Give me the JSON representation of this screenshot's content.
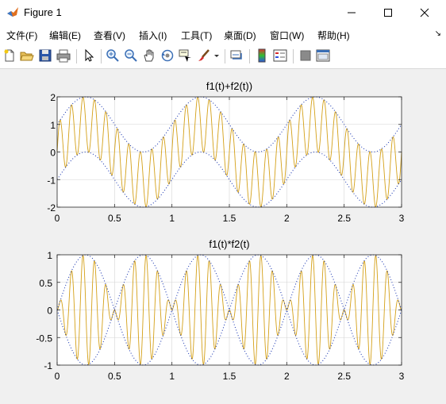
{
  "window": {
    "title": "Figure 1"
  },
  "menu": [
    "文件(F)",
    "编辑(E)",
    "查看(V)",
    "插入(I)",
    "工具(T)",
    "桌面(D)",
    "窗口(W)",
    "帮助(H)"
  ],
  "toolbar_icons": [
    "new-figure-icon",
    "open-file-icon",
    "save-icon",
    "print-icon",
    "edit-plot-arrow-icon",
    "zoom-in-icon",
    "zoom-out-icon",
    "pan-hand-icon",
    "rotate-3d-icon",
    "data-cursor-icon",
    "brush-icon",
    "link-plot-icon",
    "insert-colorbar-icon",
    "insert-legend-icon",
    "hide-plot-tools-icon",
    "show-plot-tools-icon"
  ],
  "colors": {
    "signal": "#d4a017",
    "envelope": "#1f3bb3",
    "grid": "#d6d6d6",
    "axes_bg": "#ffffff"
  },
  "chart_data": [
    {
      "type": "line",
      "title": "f1(t)+f2(t))",
      "xlim": [
        0,
        3
      ],
      "ylim": [
        -2,
        2
      ],
      "xticks": [
        "0",
        "0.5",
        "1",
        "1.5",
        "2",
        "2.5",
        "3"
      ],
      "yticks": [
        "2",
        "1",
        "0",
        "-1",
        "-2"
      ],
      "grid": true,
      "series": [
        {
          "role": "signal",
          "style": "solid",
          "formula": "sin(2*pi*10*t) + sin(2*pi*t)",
          "samples": 1200
        },
        {
          "role": "upper-envelope",
          "style": "dotted",
          "formula": "1 + sin(2*pi*t)",
          "samples": 300
        },
        {
          "role": "lower-envelope",
          "style": "dotted",
          "formula": "-1 + sin(2*pi*t)",
          "samples": 300
        }
      ]
    },
    {
      "type": "line",
      "title": "f1(t)*f2(t)",
      "xlim": [
        0,
        3
      ],
      "ylim": [
        -1,
        1
      ],
      "xticks": [
        "0",
        "0.5",
        "1",
        "1.5",
        "2",
        "2.5",
        "3"
      ],
      "yticks": [
        "1",
        "0.5",
        "0",
        "-0.5",
        "-1"
      ],
      "grid": true,
      "series": [
        {
          "role": "signal",
          "style": "solid",
          "formula": "sin(2*pi*10*t) * sin(2*pi*t)",
          "samples": 1200
        },
        {
          "role": "upper-envelope",
          "style": "dotted",
          "formula": "sin(2*pi*t)",
          "samples": 300
        },
        {
          "role": "lower-envelope",
          "style": "dotted",
          "formula": "-sin(2*pi*t)",
          "samples": 300
        }
      ]
    }
  ]
}
